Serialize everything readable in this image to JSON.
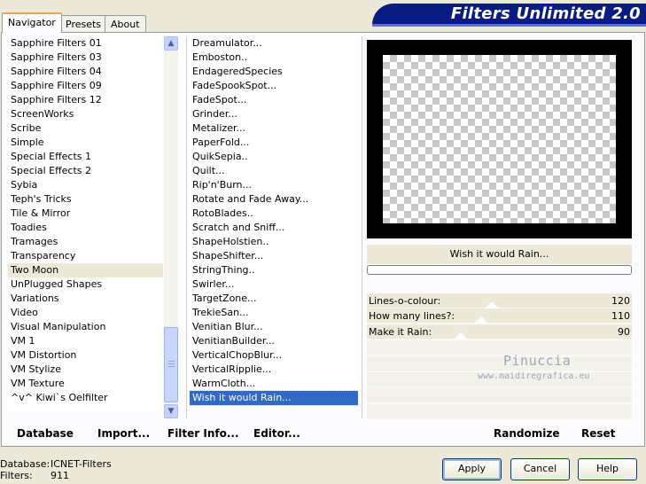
{
  "tabs": [
    {
      "label": "Navigator",
      "active": true
    },
    {
      "label": "Presets",
      "active": false
    },
    {
      "label": "About",
      "active": false
    }
  ],
  "banner": {
    "title": "Filters Unlimited 2.0"
  },
  "categories": [
    "Sapphire Filters 01",
    "Sapphire Filters 03",
    "Sapphire Filters 04",
    "Sapphire Filters 09",
    "Sapphire Filters 12",
    "ScreenWorks",
    "Scribe",
    "Simple",
    "Special Effects 1",
    "Special Effects 2",
    "Sybia",
    "Teph's Tricks",
    "Tile & Mirror",
    "Toadies",
    "Tramages",
    "Transparency",
    "Two Moon",
    "UnPlugged Shapes",
    "Variations",
    "Video",
    "Visual Manipulation",
    "VM 1",
    "VM Distortion",
    "VM Stylize",
    "VM Texture",
    "^v^ Kiwi`s Oelfilter"
  ],
  "selected_category": "Two Moon",
  "filters": [
    "Dreamulator...",
    "Emboston..",
    "EndageredSpecies",
    "FadeSpookSpot...",
    "FadeSpot...",
    "Grinder...",
    "Metalizer...",
    "PaperFold...",
    "QuikSepia..",
    "Quilt...",
    "Rip'n'Burn...",
    "Rotate and Fade Away...",
    "RotoBlades..",
    "Scratch and Sniff...",
    "ShapeHolstien..",
    "ShapeShifter...",
    "StringThing..",
    "Swirler...",
    "TargetZone...",
    "TrekieSan...",
    "Venitian Blur...",
    "VenitianBuilder...",
    "VerticalChopBlur...",
    "VerticalRipplie...",
    "WarmCloth...",
    "Wish it would Rain..."
  ],
  "selected_filter": "Wish it would Rain...",
  "preview": {
    "filter_name": "Wish it would Rain..."
  },
  "params": [
    {
      "label": "Lines-o-colour:",
      "value": "120",
      "fraction": 0.4706
    },
    {
      "label": "How many lines?:",
      "value": "110",
      "fraction": 0.4314
    },
    {
      "label": "Make it Rain:",
      "value": "90",
      "fraction": 0.3529
    }
  ],
  "watermark": {
    "line1": "Pinuccia",
    "line2": "www.maidiregrafica.eu"
  },
  "bottom_buttons": {
    "database": "Database",
    "import": "Import...",
    "filter_info": "Filter Info...",
    "editor": "Editor...",
    "randomize": "Randomize",
    "reset": "Reset"
  },
  "status": {
    "database_label": "Database:",
    "database_value": "ICNET-Filters",
    "filters_label": "Filters:",
    "filters_value": "911"
  },
  "dialog_buttons": {
    "apply": "Apply",
    "cancel": "Cancel",
    "help": "Help"
  },
  "icons": {
    "scroll_up": "chevron-up-icon",
    "scroll_down": "chevron-down-icon"
  }
}
